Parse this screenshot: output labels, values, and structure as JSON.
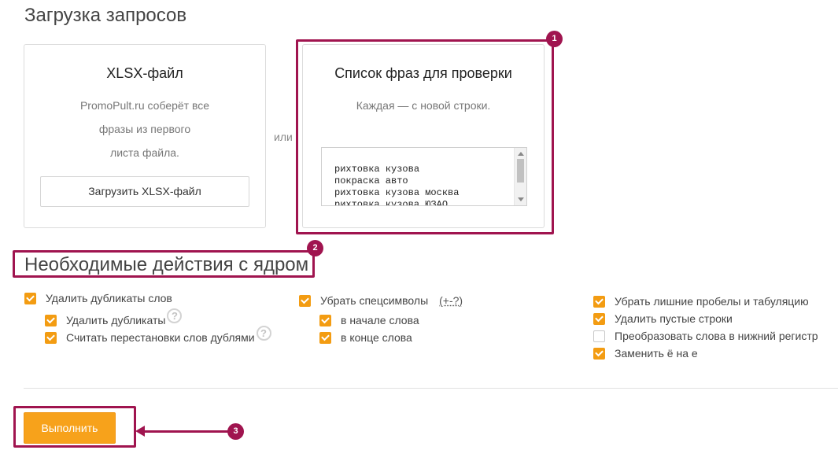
{
  "upload_section": {
    "title": "Загрузка запросов"
  },
  "xlsx_card": {
    "title": "XLSX-файл",
    "desc_lines": [
      "PromoPult.ru соберёт все",
      "фразы из первого",
      "листа файла."
    ],
    "upload_button": "Загрузить XLSX-файл"
  },
  "or_label": "или",
  "phrases_card": {
    "title": "Список фраз для проверки",
    "hint": "Каждая — с новой строки.",
    "lines": [
      "рихтовка кузова",
      "покраска авто",
      "рихтовка кузова москва",
      "рихтовка кузова ЮЗАО"
    ]
  },
  "actions_section": {
    "title": "Необходимые действия с ядром"
  },
  "col1": {
    "main": {
      "label": "Удалить дубликаты слов",
      "checked": true
    },
    "subs": [
      {
        "label": "Удалить дубликаты",
        "checked": true,
        "help": "?"
      },
      {
        "label": "Считать перестановки слов дублями",
        "checked": true,
        "help": "?"
      }
    ]
  },
  "col2": {
    "main": {
      "label": "Убрать спецсимволы",
      "checked": true,
      "link": "(+-?)"
    },
    "subs": [
      {
        "label": "в начале слова",
        "checked": true
      },
      {
        "label": "в конце слова",
        "checked": true
      }
    ]
  },
  "col3": {
    "items": [
      {
        "label": "Убрать лишние пробелы и табуляцию",
        "checked": true
      },
      {
        "label": "Удалить пустые строки",
        "checked": true
      },
      {
        "label": "Преобразовать слова в нижний регистр",
        "checked": false
      },
      {
        "label": "Заменить ё на е",
        "checked": true
      }
    ]
  },
  "run_button": "Выполнить",
  "annotations": {
    "badge1": "1",
    "badge2": "2",
    "badge3": "3",
    "color": "#a0144f"
  },
  "colors": {
    "accent": "#f7a21b"
  }
}
